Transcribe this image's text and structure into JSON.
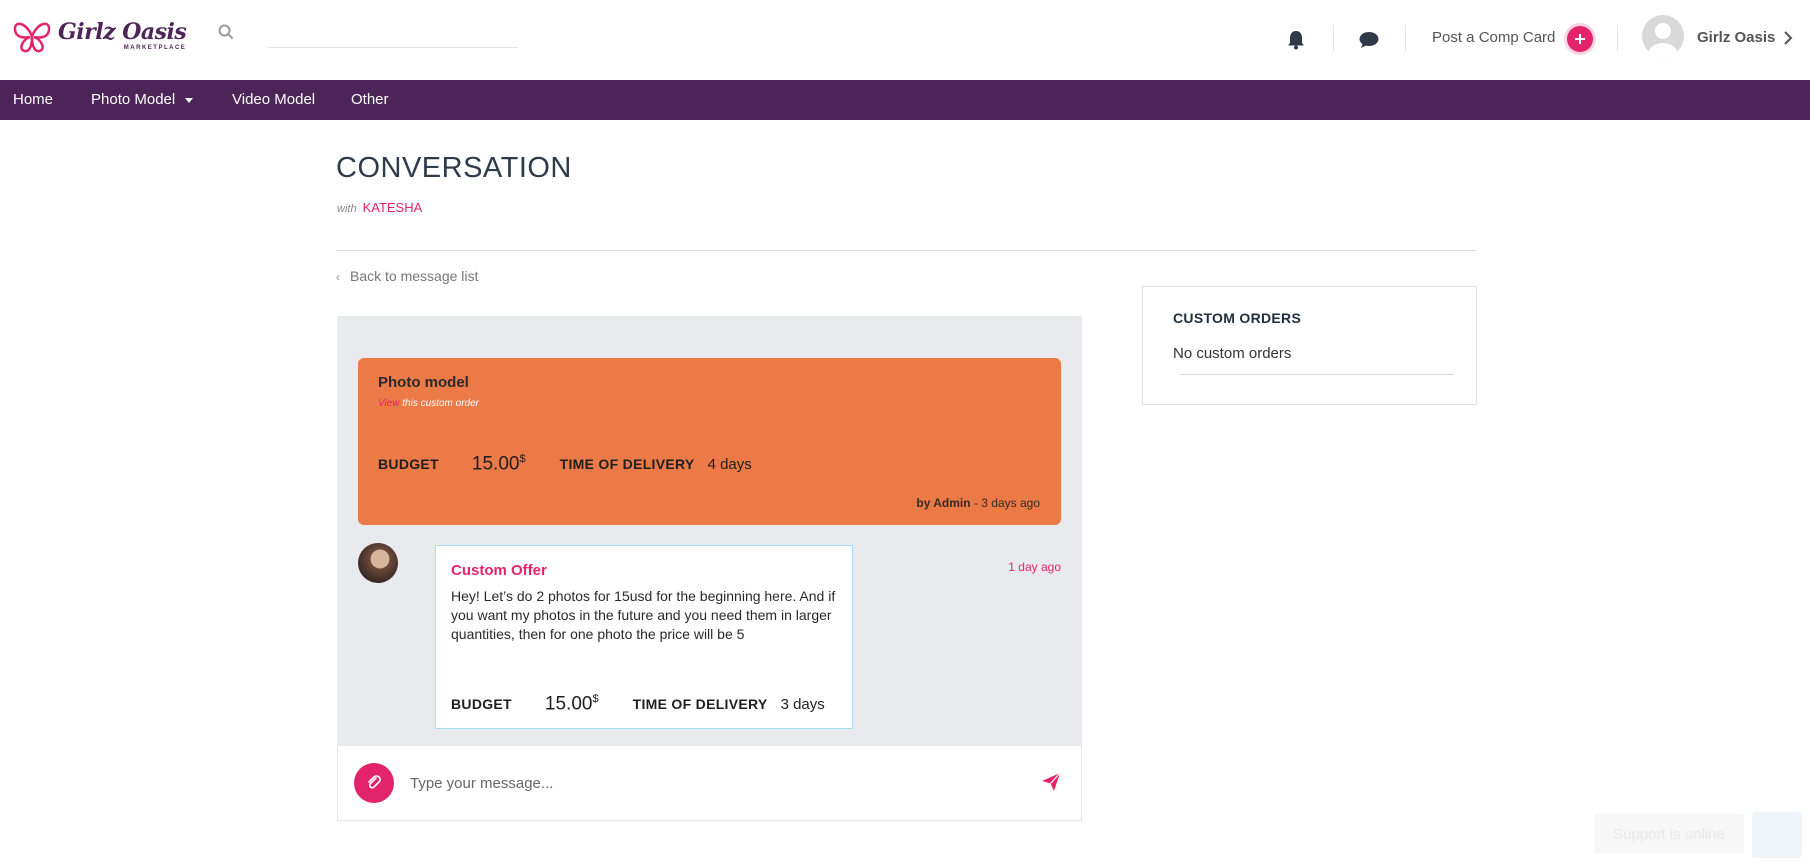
{
  "header": {
    "logo_main": "Girlz Oasis",
    "logo_sub": "MARKETPLACE",
    "search_placeholder": "",
    "post_link": "Post a Comp Card",
    "user_name": "Girlz Oasis"
  },
  "nav": {
    "items": [
      "Home",
      "Photo Model",
      "Video Model",
      "Other"
    ]
  },
  "page": {
    "title": "CONVERSATION",
    "with_word": "with",
    "with_name": "KATESHA",
    "back_link": "Back to message list"
  },
  "order_card": {
    "title": "Photo model",
    "view_link": "View",
    "view_rest": "this custom order",
    "budget_label": "BUDGET",
    "budget_value": "15.00",
    "currency": "$",
    "delivery_label": "TIME OF DELIVERY",
    "delivery_value": "4 days",
    "by_label": "by Admin",
    "by_time": "- 3 days ago",
    "color": "#eb7a46"
  },
  "offer": {
    "title": "Custom Offer",
    "body": "Hey! Let’s do 2 photos for 15usd for the beginning here. And if you want my photos in the future and you need them in larger quantities, then for one photo the price will be 5",
    "budget_label": "BUDGET",
    "budget_value": "15.00",
    "currency": "$",
    "delivery_label": "TIME OF DELIVERY",
    "delivery_value": "3 days",
    "time": "1 day ago"
  },
  "composer": {
    "placeholder": "Type your message..."
  },
  "sidebar": {
    "orders_title": "CUSTOM ORDERS",
    "orders_empty": "No custom orders"
  },
  "support": {
    "label": "Support is online"
  },
  "colors": {
    "brand_purple": "#4d2457",
    "accent_pink": "#e3246b",
    "panel_bg": "#e9eaee"
  },
  "icons": [
    "butterfly-logo-icon",
    "search-icon",
    "bell-icon",
    "chat-icon",
    "plus-icon",
    "user-avatar-icon",
    "chevron-right-icon",
    "caret-down-icon",
    "chevron-left-icon",
    "paperclip-icon",
    "send-icon"
  ]
}
